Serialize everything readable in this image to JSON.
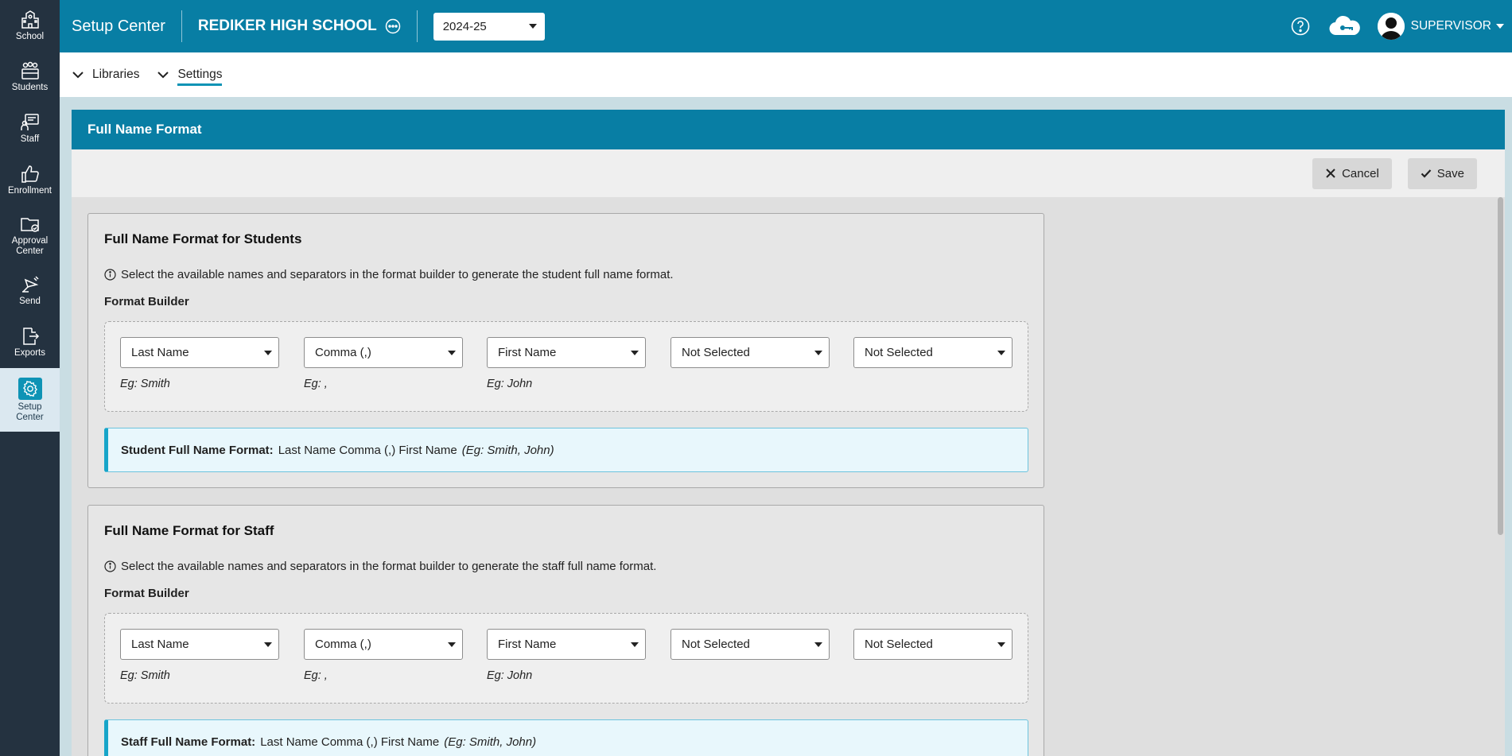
{
  "nav": [
    {
      "label": "School",
      "icon": "school-icon"
    },
    {
      "label": "Students",
      "icon": "students-icon"
    },
    {
      "label": "Staff",
      "icon": "staff-icon"
    },
    {
      "label": "Enrollment",
      "icon": "thumbs-up-icon"
    },
    {
      "label_line1": "Approval",
      "label_line2": "Center",
      "icon": "folder-check-icon"
    },
    {
      "label": "Send",
      "icon": "send-icon"
    },
    {
      "label": "Exports",
      "icon": "export-icon"
    },
    {
      "label_line1": "Setup",
      "label_line2": "Center",
      "icon": "gear-icon"
    }
  ],
  "topbar": {
    "app_title": "Setup Center",
    "school": "REDIKER HIGH SCHOOL",
    "year": "2024-25",
    "user": "SUPERVISOR"
  },
  "subnav": {
    "libraries": "Libraries",
    "settings": "Settings"
  },
  "panel": {
    "title": "Full Name Format",
    "cancel": "Cancel",
    "save": "Save"
  },
  "students": {
    "heading": "Full Name Format for Students",
    "info": "Select the available names and separators in the format builder to generate the student full name format.",
    "builder_label": "Format Builder",
    "slots": [
      {
        "value": "Last Name",
        "eg": "Eg: Smith"
      },
      {
        "value": "Comma (,)",
        "eg": "Eg: ,"
      },
      {
        "value": "First Name",
        "eg": "Eg: John"
      },
      {
        "value": "Not Selected",
        "eg": ""
      },
      {
        "value": "Not Selected",
        "eg": ""
      }
    ],
    "result_label": "Student Full Name Format:",
    "result_value": "Last Name Comma (,) First Name",
    "result_eg": "(Eg: Smith, John)"
  },
  "staff": {
    "heading": "Full Name Format for Staff",
    "info": "Select the available names and separators in the format builder to generate the staff full name format.",
    "builder_label": "Format Builder",
    "slots": [
      {
        "value": "Last Name",
        "eg": "Eg: Smith"
      },
      {
        "value": "Comma (,)",
        "eg": "Eg: ,"
      },
      {
        "value": "First Name",
        "eg": "Eg: John"
      },
      {
        "value": "Not Selected",
        "eg": ""
      },
      {
        "value": "Not Selected",
        "eg": ""
      }
    ],
    "result_label": "Staff Full Name Format:",
    "result_value": "Last Name Comma (,) First Name",
    "result_eg": "(Eg: Smith, John)"
  },
  "colors": {
    "primary": "#087ea4",
    "sidebar": "#243240",
    "accent": "#0e93b5"
  }
}
